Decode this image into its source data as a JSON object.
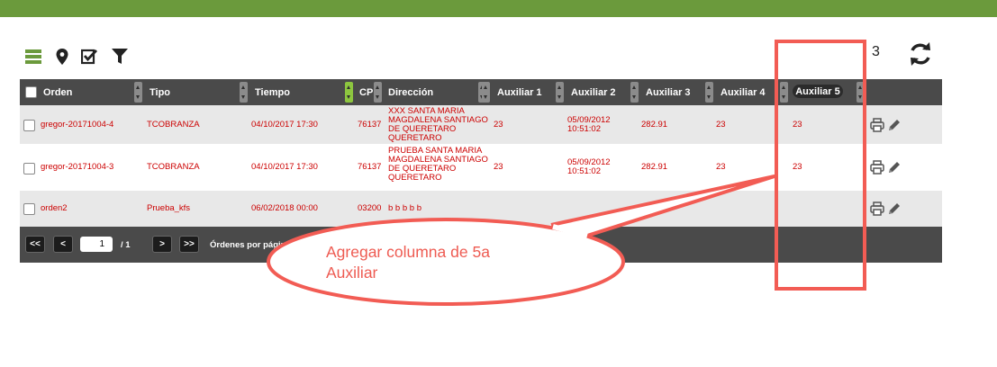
{
  "toolbar": {
    "icons": [
      "list-icon",
      "map-pin-icon",
      "check-edit-icon",
      "filter-icon"
    ],
    "count": "3",
    "refresh_icon": "refresh-icon"
  },
  "table": {
    "headers": {
      "orden": "Orden",
      "tipo": "Tipo",
      "tiempo": "Tiempo",
      "cp": "CP",
      "direccion": "Dirección",
      "aux1": "Auxiliar 1",
      "aux2": "Auxiliar 2",
      "aux3": "Auxiliar 3",
      "aux4": "Auxiliar 4",
      "aux5": "Auxiliar 5"
    },
    "rows": [
      {
        "orden": "gregor-20171004-4",
        "tipo": "TCOBRANZA",
        "tiempo": "04/10/2017 17:30",
        "cp": "76137",
        "direccion": [
          "XXX SANTA MARIA",
          "MAGDALENA SANTIAGO",
          "DE QUERETARO",
          "QUERETARO"
        ],
        "aux1": "23",
        "aux2": [
          "05/09/2012",
          "10:51:02"
        ],
        "aux3": "282.91",
        "aux4": "23",
        "aux5": "23"
      },
      {
        "orden": "gregor-20171004-3",
        "tipo": "TCOBRANZA",
        "tiempo": "04/10/2017 17:30",
        "cp": "76137",
        "direccion": [
          "PRUEBA SANTA MARIA",
          "MAGDALENA SANTIAGO",
          "DE QUERETARO",
          "QUERETARO"
        ],
        "aux1": "23",
        "aux2": [
          "05/09/2012",
          "10:51:02"
        ],
        "aux3": "282.91",
        "aux4": "23",
        "aux5": "23"
      },
      {
        "orden": "orden2",
        "tipo": "Prueba_kfs",
        "tiempo": "06/02/2018 00:00",
        "cp": "03200",
        "direccion": [
          "b b b b b"
        ],
        "aux1": "",
        "aux2": [
          "",
          ""
        ],
        "aux3": "",
        "aux4": "",
        "aux5": ""
      }
    ],
    "row_actions": [
      "printer-icon",
      "pencil-icon"
    ]
  },
  "pagination": {
    "first": "<<",
    "prev": "<",
    "page_value": "1",
    "of_text": "/  1",
    "next": ">",
    "last": ">>",
    "per_page_label": "Órdenes por págin"
  },
  "annotation": {
    "callout_line1": "Agregar columna de 5a",
    "callout_line2": "Auxiliar",
    "color": "#f25c54"
  },
  "colors": {
    "topbar": "#6b9a3c",
    "header_bg": "#4a4a4a",
    "cell_text": "#cc0000",
    "icon_green": "#6b9a3c"
  }
}
